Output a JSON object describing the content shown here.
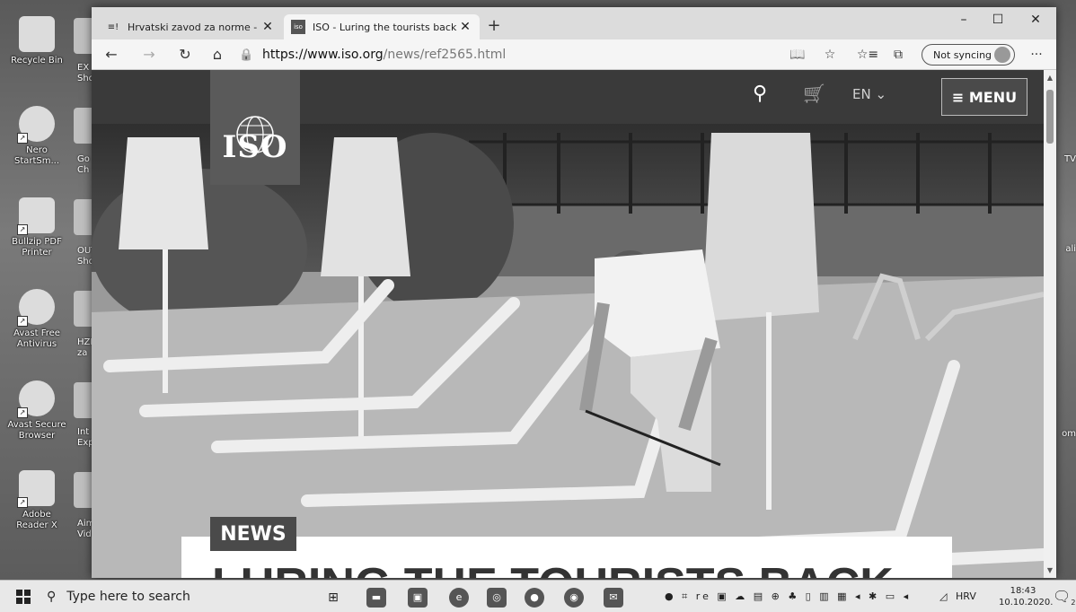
{
  "desktop": {
    "icons": [
      {
        "label": "Recycle Bin",
        "glyph": "♻"
      },
      {
        "label": "Nero\nStartSm...",
        "glyph": "✹"
      },
      {
        "label": "Bullzip PDF\nPrinter",
        "glyph": "PDF"
      },
      {
        "label": "Avast Free\nAntivirus",
        "glyph": "a"
      },
      {
        "label": "Avast Secure\nBrowser",
        "glyph": "✣"
      },
      {
        "label": "Adobe\nReader X",
        "glyph": "⅄"
      }
    ],
    "peek_labels": [
      "EX\nSho",
      "Go\nCh",
      "OUT\nSho",
      "HZN\nza",
      "Int\nExp",
      "Aim\nVide"
    ],
    "right_peek": [
      "TV",
      "ali",
      "om"
    ]
  },
  "browser": {
    "tabs": [
      {
        "title": "Hrvatski zavod za norme - Naslo",
        "icon": "≡!",
        "active": false
      },
      {
        "title": "ISO - Luring the tourists back",
        "icon": "iso",
        "active": true
      }
    ],
    "new_tab": "+",
    "window_controls": {
      "minimize": "–",
      "maximize": "☐",
      "close": "✕"
    },
    "nav": {
      "back": "←",
      "forward": "→",
      "refresh": "↻",
      "home": "⌂"
    },
    "url": {
      "host": "https://www.iso.org",
      "path": "/news/ref2565.html"
    },
    "toolbar_icons": {
      "reader": "📖",
      "favorite": "☆",
      "favorites": "☆≡",
      "collections": "⧉",
      "more": "···"
    },
    "sync_label": "Not syncing"
  },
  "site": {
    "logo_text": "ISO",
    "lang": "EN ⌄",
    "menu_label": "≡ MENU",
    "news_tag": "NEWS",
    "headline": "LURING THE TOURISTS BACK"
  },
  "taskbar": {
    "search_placeholder": "Type here to search",
    "language": "HRV",
    "time": "18:43",
    "date": "10.10.2020.",
    "notification_count": "2"
  }
}
